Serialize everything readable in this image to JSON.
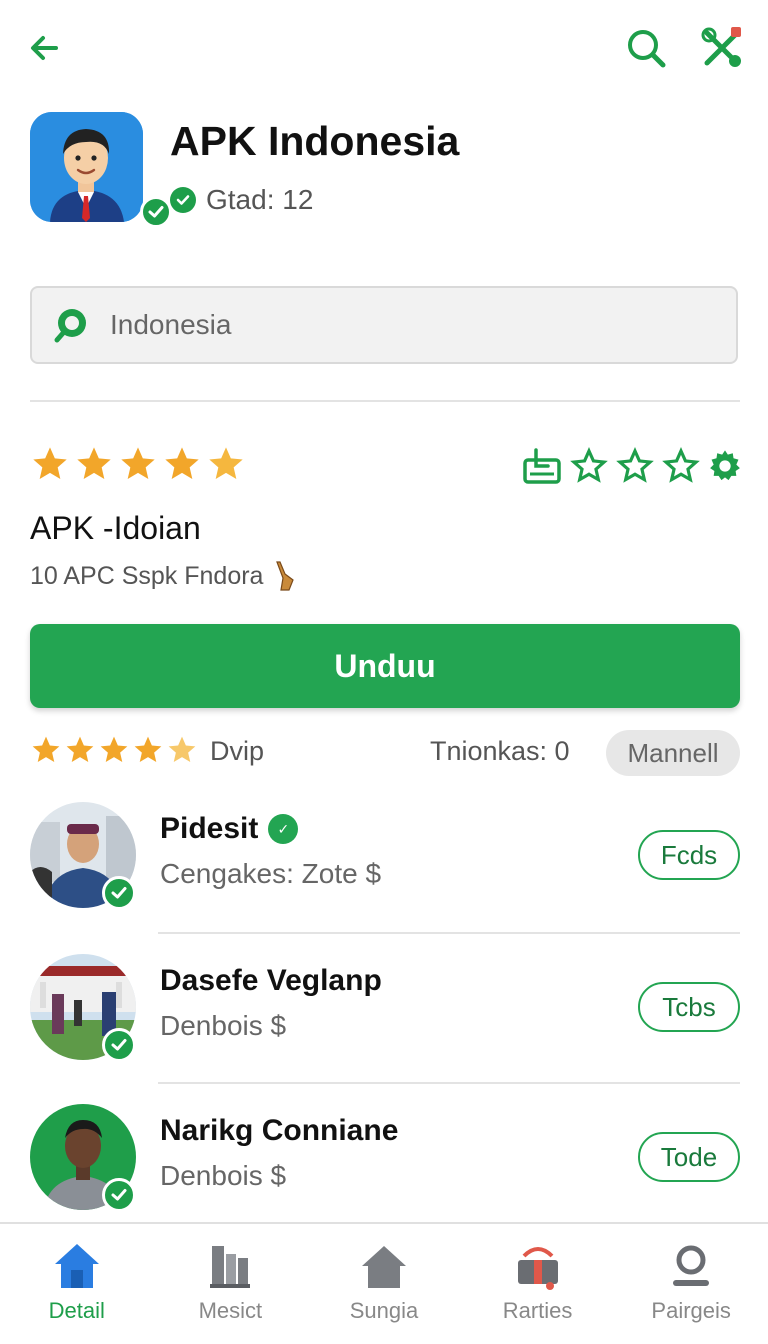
{
  "app": {
    "title": "APK Indonesia",
    "meta": "Gtad: 12"
  },
  "search": {
    "value": "Indonesia"
  },
  "rating": {
    "stars_filled": 5,
    "right_stars_outline": 3
  },
  "detail": {
    "subtitle": "APK -Idoian",
    "description": "10 APC Sspk Fndora"
  },
  "download": {
    "label": "Unduu"
  },
  "meta_row": {
    "label": "Dvip",
    "info": "Tnionkas: 0",
    "pill": "Mannell"
  },
  "list": [
    {
      "name": "Pidesit",
      "sub": "Cengakes: Zote $",
      "button": "Fcds",
      "verified": true
    },
    {
      "name": "Dasefe Veglanp",
      "sub": "Denbois $",
      "button": "Tcbs",
      "verified": false
    },
    {
      "name": "Narikg Conniane",
      "sub": "Denbois $",
      "button": "Tode",
      "verified": false
    }
  ],
  "nav": [
    {
      "label": "Detail",
      "icon": "home-icon",
      "active": true
    },
    {
      "label": "Mesict",
      "icon": "books-icon",
      "active": false
    },
    {
      "label": "Sungia",
      "icon": "house-icon",
      "active": false
    },
    {
      "label": "Rarties",
      "icon": "gift-icon",
      "active": false
    },
    {
      "label": "Pairgeis",
      "icon": "person-icon",
      "active": false
    }
  ],
  "colors": {
    "primary_green": "#23a552",
    "star_gold": "#f2a62a",
    "active_nav_blue": "#2a7de1"
  }
}
